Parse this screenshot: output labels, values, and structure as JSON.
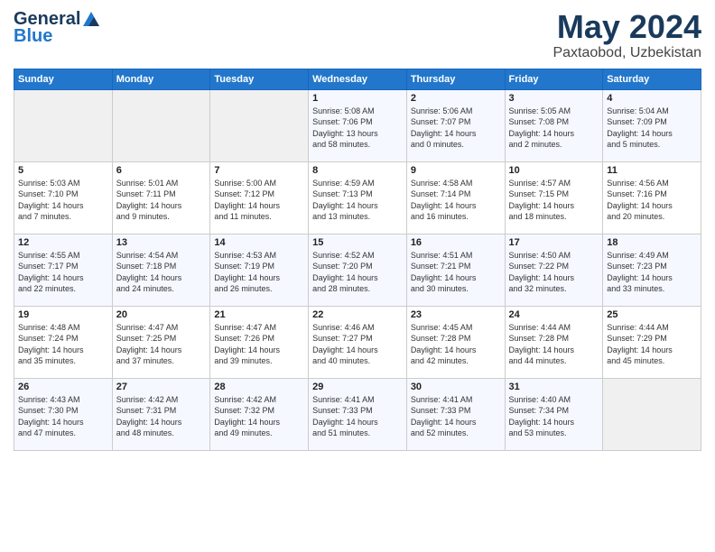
{
  "logo": {
    "general": "General",
    "blue": "Blue"
  },
  "title": "May 2024",
  "location": "Paxtaobod, Uzbekistan",
  "days": [
    "Sunday",
    "Monday",
    "Tuesday",
    "Wednesday",
    "Thursday",
    "Friday",
    "Saturday"
  ],
  "weeks": [
    [
      {
        "day": "",
        "content": ""
      },
      {
        "day": "",
        "content": ""
      },
      {
        "day": "",
        "content": ""
      },
      {
        "day": "1",
        "content": "Sunrise: 5:08 AM\nSunset: 7:06 PM\nDaylight: 13 hours\nand 58 minutes."
      },
      {
        "day": "2",
        "content": "Sunrise: 5:06 AM\nSunset: 7:07 PM\nDaylight: 14 hours\nand 0 minutes."
      },
      {
        "day": "3",
        "content": "Sunrise: 5:05 AM\nSunset: 7:08 PM\nDaylight: 14 hours\nand 2 minutes."
      },
      {
        "day": "4",
        "content": "Sunrise: 5:04 AM\nSunset: 7:09 PM\nDaylight: 14 hours\nand 5 minutes."
      }
    ],
    [
      {
        "day": "5",
        "content": "Sunrise: 5:03 AM\nSunset: 7:10 PM\nDaylight: 14 hours\nand 7 minutes."
      },
      {
        "day": "6",
        "content": "Sunrise: 5:01 AM\nSunset: 7:11 PM\nDaylight: 14 hours\nand 9 minutes."
      },
      {
        "day": "7",
        "content": "Sunrise: 5:00 AM\nSunset: 7:12 PM\nDaylight: 14 hours\nand 11 minutes."
      },
      {
        "day": "8",
        "content": "Sunrise: 4:59 AM\nSunset: 7:13 PM\nDaylight: 14 hours\nand 13 minutes."
      },
      {
        "day": "9",
        "content": "Sunrise: 4:58 AM\nSunset: 7:14 PM\nDaylight: 14 hours\nand 16 minutes."
      },
      {
        "day": "10",
        "content": "Sunrise: 4:57 AM\nSunset: 7:15 PM\nDaylight: 14 hours\nand 18 minutes."
      },
      {
        "day": "11",
        "content": "Sunrise: 4:56 AM\nSunset: 7:16 PM\nDaylight: 14 hours\nand 20 minutes."
      }
    ],
    [
      {
        "day": "12",
        "content": "Sunrise: 4:55 AM\nSunset: 7:17 PM\nDaylight: 14 hours\nand 22 minutes."
      },
      {
        "day": "13",
        "content": "Sunrise: 4:54 AM\nSunset: 7:18 PM\nDaylight: 14 hours\nand 24 minutes."
      },
      {
        "day": "14",
        "content": "Sunrise: 4:53 AM\nSunset: 7:19 PM\nDaylight: 14 hours\nand 26 minutes."
      },
      {
        "day": "15",
        "content": "Sunrise: 4:52 AM\nSunset: 7:20 PM\nDaylight: 14 hours\nand 28 minutes."
      },
      {
        "day": "16",
        "content": "Sunrise: 4:51 AM\nSunset: 7:21 PM\nDaylight: 14 hours\nand 30 minutes."
      },
      {
        "day": "17",
        "content": "Sunrise: 4:50 AM\nSunset: 7:22 PM\nDaylight: 14 hours\nand 32 minutes."
      },
      {
        "day": "18",
        "content": "Sunrise: 4:49 AM\nSunset: 7:23 PM\nDaylight: 14 hours\nand 33 minutes."
      }
    ],
    [
      {
        "day": "19",
        "content": "Sunrise: 4:48 AM\nSunset: 7:24 PM\nDaylight: 14 hours\nand 35 minutes."
      },
      {
        "day": "20",
        "content": "Sunrise: 4:47 AM\nSunset: 7:25 PM\nDaylight: 14 hours\nand 37 minutes."
      },
      {
        "day": "21",
        "content": "Sunrise: 4:47 AM\nSunset: 7:26 PM\nDaylight: 14 hours\nand 39 minutes."
      },
      {
        "day": "22",
        "content": "Sunrise: 4:46 AM\nSunset: 7:27 PM\nDaylight: 14 hours\nand 40 minutes."
      },
      {
        "day": "23",
        "content": "Sunrise: 4:45 AM\nSunset: 7:28 PM\nDaylight: 14 hours\nand 42 minutes."
      },
      {
        "day": "24",
        "content": "Sunrise: 4:44 AM\nSunset: 7:28 PM\nDaylight: 14 hours\nand 44 minutes."
      },
      {
        "day": "25",
        "content": "Sunrise: 4:44 AM\nSunset: 7:29 PM\nDaylight: 14 hours\nand 45 minutes."
      }
    ],
    [
      {
        "day": "26",
        "content": "Sunrise: 4:43 AM\nSunset: 7:30 PM\nDaylight: 14 hours\nand 47 minutes."
      },
      {
        "day": "27",
        "content": "Sunrise: 4:42 AM\nSunset: 7:31 PM\nDaylight: 14 hours\nand 48 minutes."
      },
      {
        "day": "28",
        "content": "Sunrise: 4:42 AM\nSunset: 7:32 PM\nDaylight: 14 hours\nand 49 minutes."
      },
      {
        "day": "29",
        "content": "Sunrise: 4:41 AM\nSunset: 7:33 PM\nDaylight: 14 hours\nand 51 minutes."
      },
      {
        "day": "30",
        "content": "Sunrise: 4:41 AM\nSunset: 7:33 PM\nDaylight: 14 hours\nand 52 minutes."
      },
      {
        "day": "31",
        "content": "Sunrise: 4:40 AM\nSunset: 7:34 PM\nDaylight: 14 hours\nand 53 minutes."
      },
      {
        "day": "",
        "content": ""
      }
    ]
  ]
}
